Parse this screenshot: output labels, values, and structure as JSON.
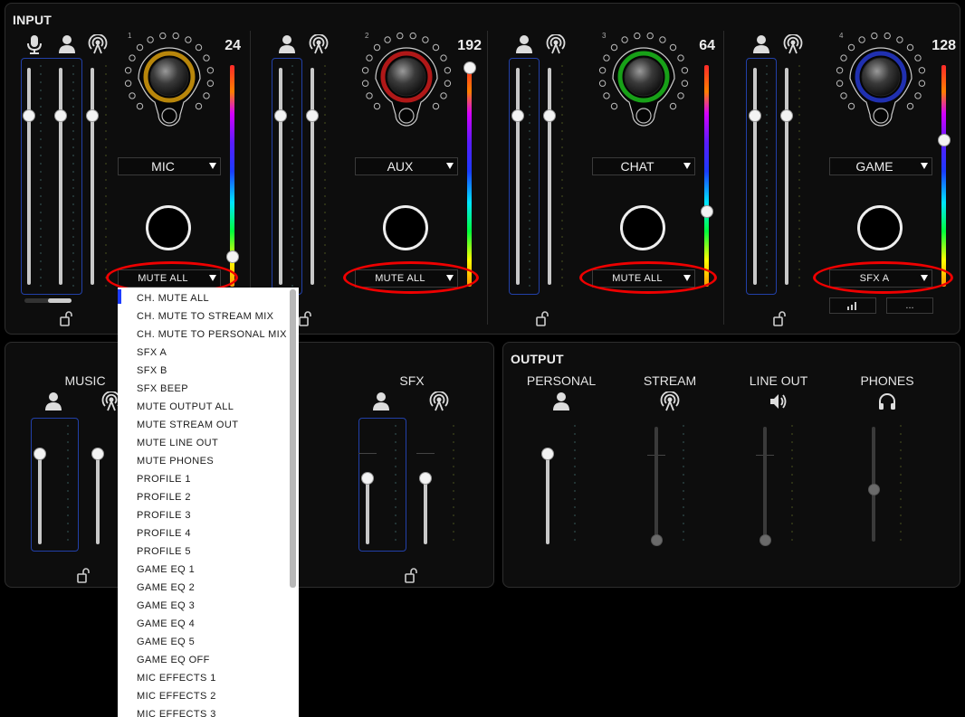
{
  "input": {
    "title": "INPUT",
    "channels": [
      {
        "number": "1",
        "value": "24",
        "select": "MIC",
        "action": "MUTE ALL",
        "knob_color": "#b8860b"
      },
      {
        "number": "2",
        "value": "192",
        "select": "AUX",
        "action": "MUTE ALL",
        "knob_color": "#b01818"
      },
      {
        "number": "3",
        "value": "64",
        "select": "CHAT",
        "action": "MUTE ALL",
        "knob_color": "#18a018"
      },
      {
        "number": "4",
        "value": "128",
        "select": "GAME",
        "action": "SFX A",
        "knob_color": "#2030b0"
      }
    ],
    "extra_buttons": [
      "...",
      "..."
    ]
  },
  "music": {
    "label": "MUSIC"
  },
  "sfx": {
    "label": "SFX"
  },
  "output": {
    "title": "OUTPUT",
    "channels": [
      "PERSONAL",
      "STREAM",
      "LINE OUT",
      "PHONES"
    ]
  },
  "dropdown": {
    "items": [
      "CH. MUTE ALL",
      "CH. MUTE TO STREAM MIX",
      "CH. MUTE TO PERSONAL MIX",
      "SFX A",
      "SFX B",
      "SFX BEEP",
      "MUTE OUTPUT ALL",
      "MUTE STREAM OUT",
      "MUTE LINE OUT",
      "MUTE PHONES",
      "PROFILE 1",
      "PROFILE 2",
      "PROFILE 3",
      "PROFILE 4",
      "PROFILE 5",
      "GAME EQ 1",
      "GAME EQ 2",
      "GAME EQ 3",
      "GAME EQ 4",
      "GAME EQ 5",
      "GAME EQ OFF",
      "MIC EFFECTS 1",
      "MIC EFFECTS 2",
      "MIC EFFECTS 3"
    ]
  },
  "colors": {
    "fader_group_border": "#2240a8",
    "highlight": "#e00000"
  }
}
